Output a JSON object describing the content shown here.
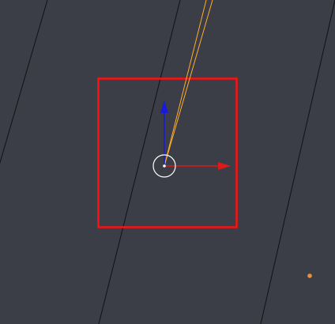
{
  "viewport": {
    "background_color": "#3b3d47",
    "grid_line_color": "#111216",
    "selection_color": "#ff1010",
    "origin_color": "#ffffff",
    "light_line_color": "#ffae2c",
    "point_color": "#e8913c"
  },
  "gizmo": {
    "x_axis_color": "#dd1a1a",
    "y_axis_color": "#1a1add"
  },
  "icons": {
    "origin": "circle-origin-icon",
    "light_point": "dot-icon"
  }
}
